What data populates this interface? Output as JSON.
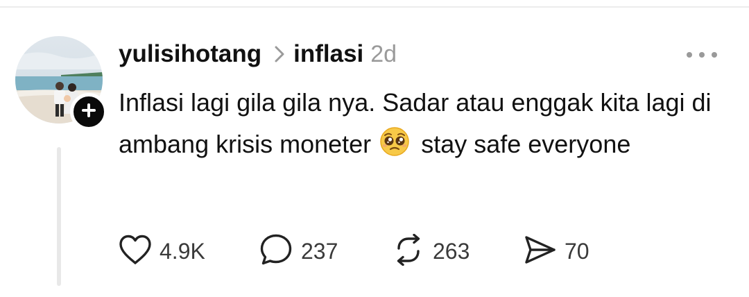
{
  "post": {
    "username": "yulisihotang",
    "topic": "inflasi",
    "time": "2d",
    "text_before_emoji": "Inflasi lagi gila gila nya. Sadar atau enggak kita lagi di ambang krisis moneter",
    "emoji": "pleading-face-emoji",
    "text_after_emoji": "stay safe everyone"
  },
  "actions": {
    "likes": "4.9K",
    "replies": "237",
    "reposts": "263",
    "shares": "70"
  },
  "icons": {
    "avatar": "profile-photo",
    "follow": "plus-icon",
    "topic_separator": "chevron-right-icon",
    "more": "more-horizontal-icon",
    "like": "heart-icon",
    "reply": "comment-icon",
    "repost": "repost-icon",
    "share": "send-icon"
  },
  "colors": {
    "text": "#111111",
    "muted": "#9a9a9a",
    "count": "#3a3a3a",
    "badge": "#0a0a0a"
  }
}
